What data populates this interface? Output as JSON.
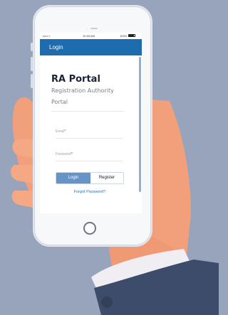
{
  "status_bar": {
    "signal": "•••••",
    "wifi": "≈",
    "time": "10:30 AM",
    "battery": "100%"
  },
  "nav": {
    "title": "Login"
  },
  "app": {
    "title": "RA Portal",
    "subtitle": "Registration Authority Portal"
  },
  "form": {
    "email_label": "Email",
    "password_label": "Password",
    "required_mark": "*",
    "login_label": "Login",
    "register_label": "Register",
    "forgot_label": "Forgot Password?"
  },
  "colors": {
    "background": "#97a4bb",
    "navbar": "#1e6cae",
    "primary_button": "#6794c6",
    "link": "#2f6fbf",
    "sleeve": "#3d4c6a",
    "skin": "#f2a07c"
  }
}
